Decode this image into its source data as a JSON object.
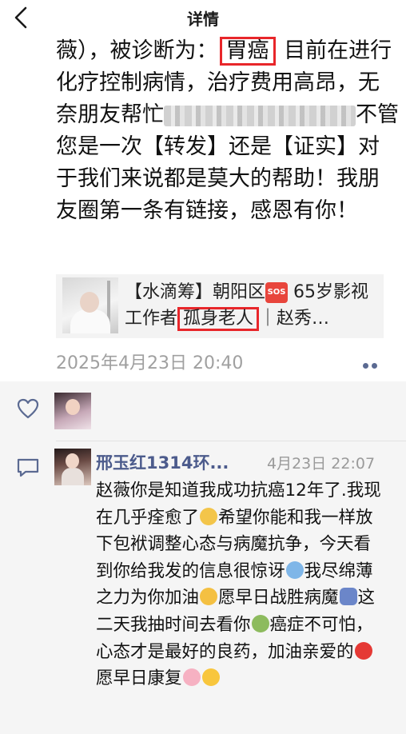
{
  "nav": {
    "title": "详情",
    "back_icon": "chevron-left-icon"
  },
  "post": {
    "line1_a": "薇），被诊断为：",
    "line1_highlight": "胃癌",
    "line1_b": "目前在进行化疗控制病情，治疗费用高昂，无奈朋友帮忙",
    "line2": "不管您是一次【转发】还是【证实】对于我们来说都是莫大的帮助！我朋友圈第一条有链接，感恩有你！",
    "link": {
      "text_a": "【水滴筹】朝阳区",
      "sos": "SOS",
      "text_b": "65岁影视工作者",
      "text_highlight": "孤身老人",
      "text_c": "｜赵秀…"
    },
    "timestamp": "2025年4月23日 20:40"
  },
  "comment": {
    "author": "邢玉红1314环...",
    "time": "4月23日 22:07",
    "p1": "赵薇你是知道我成功抗癌12年了.我现在几乎痊愈了",
    "p2": "希望你能和我一样放下包袱调整心态与病魔抗争，今天看到你给我发的信息很惊讶",
    "p3": "我尽绵薄之力为你加油",
    "p4": "愿早日战胜病魔",
    "p5": "这二天我抽时间去看你",
    "p6": "癌症不可怕，心态才是最好的良药，加油亲爱的",
    "p7": "愿早日康复"
  },
  "colors": {
    "highlight_border": "#e8262a",
    "name_blue": "#4c5b8c",
    "gray_text": "#a0a0a0"
  }
}
